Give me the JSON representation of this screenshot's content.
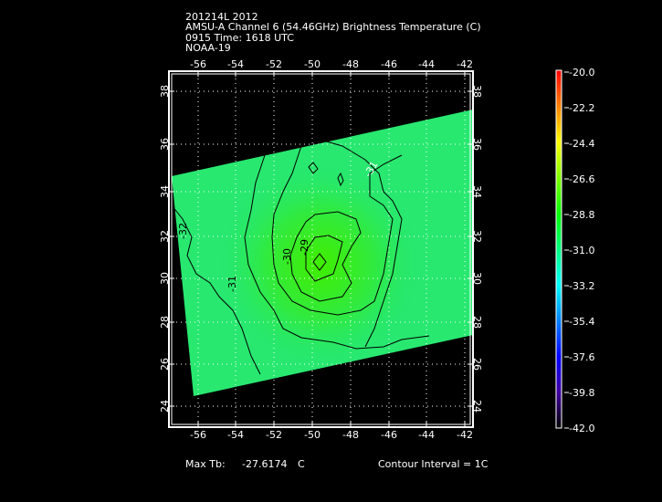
{
  "header": {
    "line1": "201214L 2012",
    "line2": "AMSU-A Channel 6 (54.46GHz) Brightness Temperature (C)",
    "line3": "0915 Time: 1618 UTC",
    "line4": "NOAA-19"
  },
  "map": {
    "lon_ticks": [
      "-56",
      "-54",
      "-52",
      "-50",
      "-48",
      "-46",
      "-44",
      "-42"
    ],
    "lat_ticks": [
      "38",
      "36",
      "34",
      "32",
      "30",
      "28",
      "26",
      "24"
    ],
    "contour_labels": [
      "-31",
      "-32",
      "-31",
      "-30",
      "-29"
    ],
    "colors": {
      "swath": "#22e878",
      "core": "#44ee10",
      "contour": "#000000"
    }
  },
  "colorbar": {
    "ticks": [
      "-20.0",
      "-22.2",
      "-24.4",
      "-26.6",
      "-28.8",
      "-31.0",
      "-33.2",
      "-35.4",
      "-37.6",
      "-39.8",
      "-42.0"
    ],
    "stops": [
      "#ff0000",
      "#ff8000",
      "#ffff00",
      "#80ff00",
      "#00ff00",
      "#00ff80",
      "#00ffff",
      "#0080ff",
      "#0000ff",
      "#4000a0",
      "#000000"
    ]
  },
  "footer": {
    "max_label": "Max Tb:",
    "max_value": "-27.6174",
    "max_unit": "C",
    "contour_interval": "Contour Interval = 1C"
  }
}
